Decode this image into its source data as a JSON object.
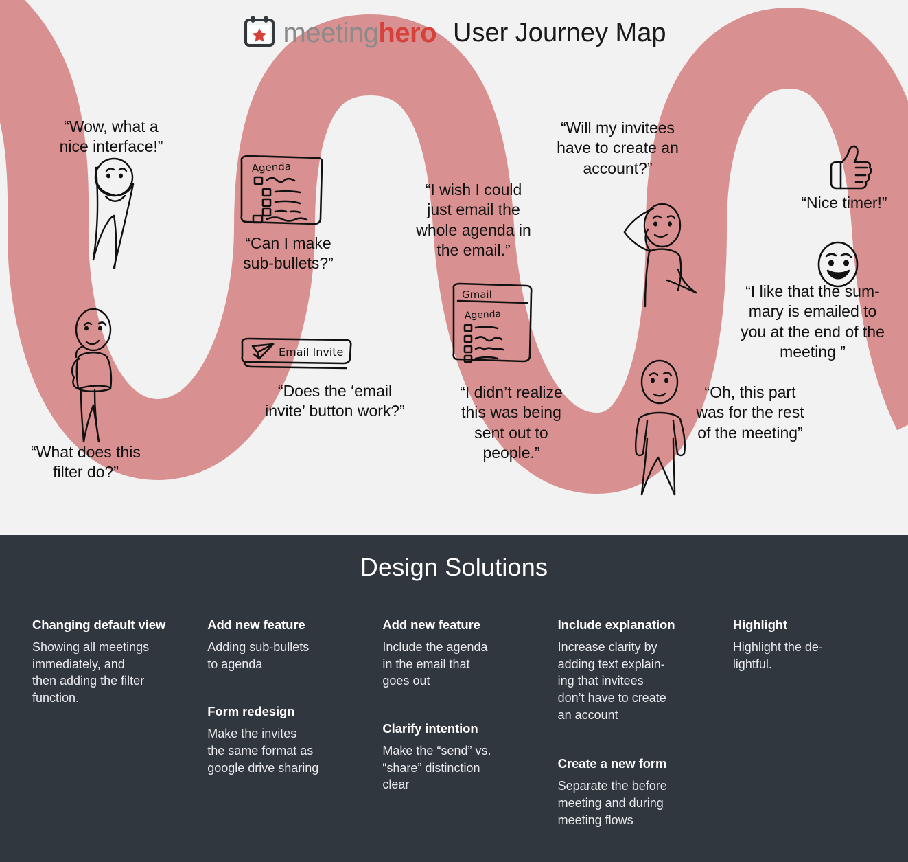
{
  "header": {
    "brand_light": "meeting",
    "brand_bold": "hero",
    "title": "User Journey Map",
    "logo_icon": "calendar-star-icon"
  },
  "colors": {
    "background": "#f2f2f2",
    "path": "#d99090",
    "accent_red": "#d6413c",
    "dark_panel": "#30373f",
    "ink": "#111111"
  },
  "journey": {
    "quotes": [
      {
        "id": "wow-nice-interface",
        "text": "“Wow, what a\nnice interface!”"
      },
      {
        "id": "what-does-filter-do",
        "text": "“What does this\nfilter do?”"
      },
      {
        "id": "can-i-make-sub-bullets",
        "text": "“Can I make\nsub-bullets?”"
      },
      {
        "id": "does-email-invite-work",
        "text": "“Does the ‘email\ninvite’ button work?”"
      },
      {
        "id": "wish-email-whole-agenda",
        "text": "“I wish I could\njust email the\nwhole agenda in\nthe email.”"
      },
      {
        "id": "didnt-realize-sent-out",
        "text": "“I didn’t realize\nthis was being\nsent out to\npeople.”"
      },
      {
        "id": "will-invitees-create-account",
        "text": "“Will my invitees\nhave to create an\naccount?”"
      },
      {
        "id": "oh-this-part-rest-of-meeting",
        "text": "“Oh, this part\nwas for the rest\nof the meeting”"
      },
      {
        "id": "nice-timer",
        "text": "“Nice timer!”"
      },
      {
        "id": "like-summary-emailed",
        "text": "“I like that the sum-\nmary is emailed to\nyou at the end of the\nmeeting ”"
      }
    ],
    "sketches": {
      "agenda_card_label": "Agenda",
      "email_invite_button_label": "Email Invite",
      "gmail_window_label": "Gmail",
      "gmail_agenda_label": "Agenda"
    },
    "figures": [
      {
        "id": "happy-arms-up-figure",
        "mood": "happy"
      },
      {
        "id": "thinking-figure",
        "mood": "puzzled"
      },
      {
        "id": "head-scratching-figure",
        "mood": "confused"
      },
      {
        "id": "standing-neutral-figure",
        "mood": "neutral"
      },
      {
        "id": "thumbs-up-icon",
        "mood": "approval"
      },
      {
        "id": "smiley-face-icon",
        "mood": "happy"
      }
    ]
  },
  "solutions": {
    "title": "Design Solutions",
    "columns": [
      {
        "items": [
          {
            "head": "Changing default view",
            "body": "Showing all meetings\nimmediately, and\nthen adding the filter\nfunction."
          }
        ]
      },
      {
        "items": [
          {
            "head": "Add new feature",
            "body": "Adding sub-bullets\nto agenda"
          },
          {
            "head": "Form redesign",
            "body": "Make the invites\nthe same format as\ngoogle drive sharing"
          }
        ]
      },
      {
        "items": [
          {
            "head": "Add new feature",
            "body": "Include the agenda\nin the email that\ngoes out"
          },
          {
            "head": "Clarify intention",
            "body": "Make the “send” vs.\n“share” distinction\nclear"
          }
        ]
      },
      {
        "items": [
          {
            "head": "Include explanation",
            "body": "Increase clarity by\nadding text explain-\ning  that invitees\ndon’t have to create\nan account"
          },
          {
            "head": "Create a new form",
            "body": "Separate the before\nmeeting and during\nmeeting flows"
          }
        ]
      },
      {
        "items": [
          {
            "head": "Highlight",
            "body": "Highlight the de-\nlightful."
          }
        ]
      }
    ]
  }
}
